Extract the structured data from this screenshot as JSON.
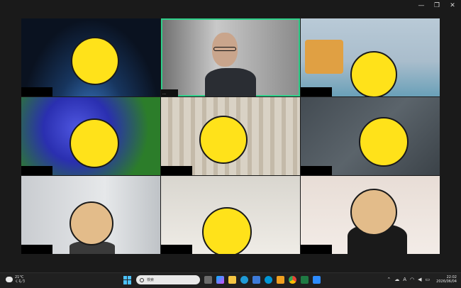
{
  "window": {
    "controls": [
      "—",
      "❐",
      "✕"
    ]
  },
  "tiles": [
    {
      "name": "",
      "background": "space",
      "face": "smile",
      "active": false
    },
    {
      "name": "…",
      "background": "room",
      "face": "none",
      "active": true
    },
    {
      "name": "",
      "background": "toy",
      "face": "smile",
      "active": false
    },
    {
      "name": "",
      "background": "flower",
      "face": "smile",
      "active": false
    },
    {
      "name": "",
      "background": "curtain",
      "face": "smile",
      "active": false
    },
    {
      "name": "",
      "background": "rock",
      "face": "smile",
      "active": false
    },
    {
      "name": "",
      "background": "wall1",
      "face": "laugh",
      "active": false
    },
    {
      "name": "",
      "background": "wall2",
      "face": "smile",
      "active": false
    },
    {
      "name": "",
      "background": "wall3",
      "face": "laugh",
      "active": false
    }
  ],
  "taskbar": {
    "weather_temp": "21°C",
    "weather_desc": "くもり",
    "search_placeholder": "検索",
    "time": "22:02",
    "date": "2026/06/04"
  },
  "colors": {
    "active_border": "#2fd08a",
    "accent": "#4cc2ff",
    "face_yellow": "#ffe21a"
  }
}
